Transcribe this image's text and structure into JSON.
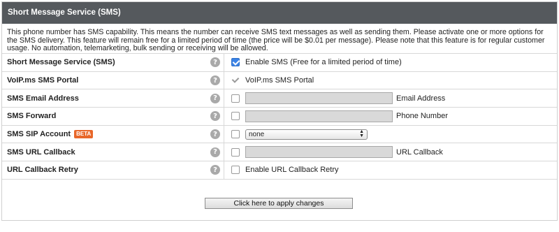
{
  "header": {
    "title": "Short Message Service (SMS)"
  },
  "description": "This phone number has SMS capability. This means the number can receive SMS text messages as well as sending them. Please activate one or more options for the SMS delivery. This feature will remain free for a limited period of time (the price will be $0.01 per message). Please note that this feature is for regular customer usage. No automation, telemarketing, bulk sending or receiving will be allowed.",
  "help_glyph": "?",
  "rows": [
    {
      "label": "Short Message Service (SMS)",
      "checkbox": "checked",
      "text": "Enable SMS (Free for a limited period of time)"
    },
    {
      "label": "VoIP.ms SMS Portal",
      "checkbox": "disabled-checked",
      "text": "VoIP.ms SMS Portal"
    },
    {
      "label": "SMS Email Address",
      "checkbox": "unchecked",
      "input_value": "",
      "text": "Email Address"
    },
    {
      "label": "SMS Forward",
      "checkbox": "unchecked",
      "input_value": "",
      "text": "Phone Number"
    },
    {
      "label": "SMS SIP Account",
      "badge": "BETA",
      "checkbox": "unchecked",
      "select_value": "none"
    },
    {
      "label": "SMS URL Callback",
      "checkbox": "unchecked",
      "input_value": "",
      "text": "URL Callback"
    },
    {
      "label": "URL Callback Retry",
      "checkbox": "unchecked",
      "text": "Enable URL Callback Retry"
    }
  ],
  "apply_button": "Click here to apply changes",
  "colors": {
    "header_bg": "#55595d",
    "checkbox_checked": "#3b83e6",
    "beta_badge": "#e8672a",
    "help_icon": "#a9a9a9"
  }
}
